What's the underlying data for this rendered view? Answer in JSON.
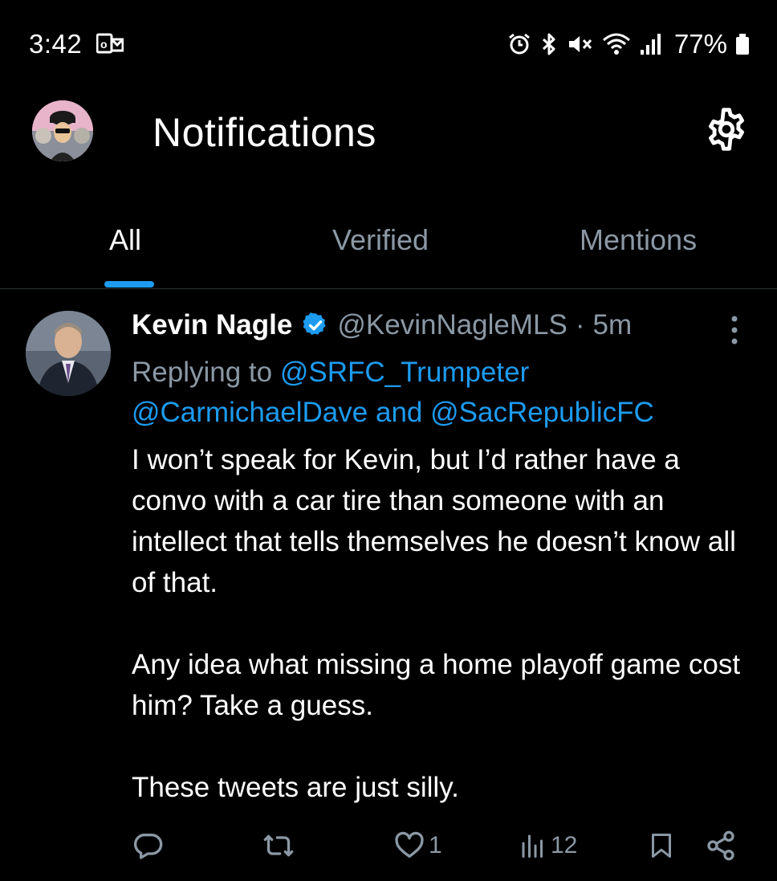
{
  "status_bar": {
    "time": "3:42",
    "battery": "77%"
  },
  "header": {
    "title": "Notifications"
  },
  "tabs": [
    {
      "label": "All",
      "active": true
    },
    {
      "label": "Verified",
      "active": false
    },
    {
      "label": "Mentions",
      "active": false
    }
  ],
  "tweet": {
    "author_name": "Kevin Nagle",
    "handle": "@KevinNagleMLS",
    "separator": "·",
    "time_ago": "5m",
    "reply_prefix": "Replying to ",
    "reply_mention_1": "@SRFC_Trumpeter",
    "reply_mention_2": "@CarmichaelDave",
    "reply_and": " and ",
    "reply_mention_3": "@SacRepublicFC",
    "paragraphs": [
      "I won’t speak for Kevin, but I’d rather have a convo with a car tire than someone with an intellect that tells themselves he doesn’t know all of that.",
      "Any idea what missing a home playoff game cost him? Take a guess.",
      "These tweets are just silly."
    ],
    "like_count": "1",
    "view_count": "12"
  },
  "colors": {
    "accent": "#1d9bf0",
    "secondary_text": "#8b98a5",
    "background": "#000000"
  },
  "icons": {
    "settings": "gear-icon",
    "verified": "verified-badge-icon",
    "more": "more-vertical-icon",
    "reply": "reply-icon",
    "retweet": "retweet-icon",
    "like": "heart-icon",
    "views": "views-icon",
    "bookmark": "bookmark-icon",
    "share": "share-icon"
  }
}
